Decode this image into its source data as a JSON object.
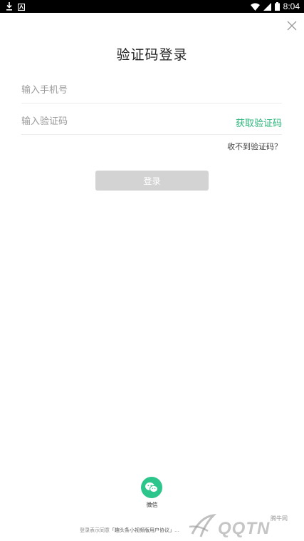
{
  "status_bar": {
    "time": "8:04",
    "left_icons": [
      "download-icon",
      "notification-icon"
    ],
    "right_icons": [
      "wifi-icon",
      "signal-icon",
      "battery-icon"
    ]
  },
  "header": {
    "close_icon": "close-icon",
    "title": "验证码登录"
  },
  "form": {
    "phone_placeholder": "输入手机号",
    "code_placeholder": "输入验证码",
    "get_code_label": "获取验证码",
    "no_code_label": "收不到验证码？",
    "login_label": "登录"
  },
  "social": {
    "wechat_label": "微信",
    "wechat_icon": "wechat-icon"
  },
  "footer": {
    "agreement_prefix": "登录表示同意",
    "agreement_link": "「趣头条小视频版用户协议」",
    "agreement_suffix": "…"
  },
  "watermark": {
    "text": "QQTN",
    "small": "腾牛网"
  },
  "colors": {
    "accent": "#2cb57c",
    "wechat": "#2cc58c",
    "disabled_button": "#d3d3d3",
    "status_bar": "#000000"
  }
}
